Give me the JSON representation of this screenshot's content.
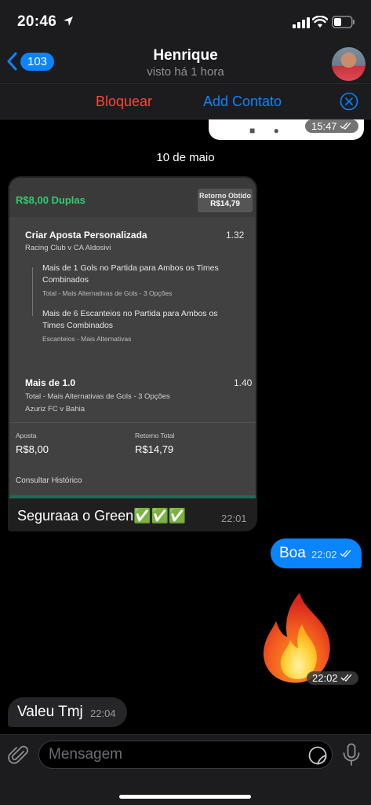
{
  "status_bar": {
    "time": "20:46"
  },
  "header": {
    "back_count": "103",
    "contact_name": "Henrique",
    "last_seen": "visto há 1 hora"
  },
  "action_bar": {
    "block_label": "Bloquear",
    "add_contact_label": "Add Contato"
  },
  "chat": {
    "previous_message_time": "15:47",
    "date_separator": "10 de maio",
    "bet_message": {
      "card": {
        "title": "R$8,00 Duplas",
        "return_label": "Retorno Obtido",
        "return_value": "R$14,79",
        "selection1_title": "Criar Aposta Personalizada",
        "selection1_odds": "1.32",
        "selection1_match": "Racing Club v CA Aldosivi",
        "leg1_text": "Mais de 1 Gols no Partida para Ambos os Times Combinados",
        "leg1_market": "Total - Mais Alternativas de Gols - 3 Opções",
        "leg2_text": "Mais de 6 Escanteios no Partida para Ambos os Times Combinados",
        "leg2_market": "Escanteios - Mais Alternativas",
        "selection2_title": "Mais de 1.0",
        "selection2_odds": "1.40",
        "selection2_market": "Total - Mais Alternativas de Gols - 3 Opções",
        "selection2_match": "Azuriz FC v Bahia",
        "stake_label": "Aposta",
        "stake_value": "R$8,00",
        "total_label": "Retorno Total",
        "total_value": "R$14,79",
        "history_link": "Consultar Histórico"
      },
      "caption": "Seguraaa o Green✅✅✅",
      "time": "22:01"
    },
    "outgoing_boa": {
      "text": "Boa",
      "time": "22:02"
    },
    "sticker": {
      "icon": "fire-emoji-sticker",
      "time": "22:02"
    },
    "incoming_valeu": {
      "text": "Valeu Tmj",
      "time": "22:04"
    }
  },
  "composer": {
    "placeholder": "Mensagem"
  },
  "colors": {
    "accent": "#0a84ff",
    "danger": "#ff453a",
    "bet_green": "#2ecc71"
  }
}
